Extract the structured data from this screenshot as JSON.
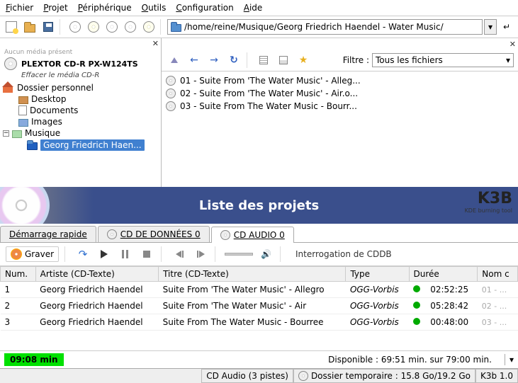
{
  "menu": {
    "file": "Fichier",
    "project": "Projet",
    "device": "Périphérique",
    "tools": "Outils",
    "config": "Configuration",
    "help": "Aide"
  },
  "path": "/home/reine/Musique/Georg Friedrich Haendel - Water Music/",
  "device": {
    "name": "PLEXTOR CD-R   PX-W124TS",
    "sub": "Effacer le média CD-R",
    "above": "Aucun média présent"
  },
  "folders": {
    "home": "Dossier personnel",
    "desktop": "Desktop",
    "documents": "Documents",
    "images": "Images",
    "music": "Musique",
    "selected": "Georg Friedrich Haen..."
  },
  "filter": {
    "label": "Filtre :",
    "value": "Tous les fichiers"
  },
  "files": [
    "01 - Suite From 'The Water Music' - Alleg...",
    "02 - Suite From 'The Water Music' - Air.o...",
    "03 - Suite From The Water Music - Bourr..."
  ],
  "project_header": {
    "title": "Liste des projets",
    "logo": "K3B",
    "logo_sub": "KDE burning tool"
  },
  "tabs": {
    "quick": "Démarrage rapide",
    "data": "CD DE DONNÉES 0",
    "audio": "CD AUDIO 0"
  },
  "proj_tb": {
    "burn": "Graver",
    "status": "Interrogation de CDDB"
  },
  "columns": {
    "num": "Num.",
    "artist": "Artiste (CD-Texte)",
    "title": "Titre (CD-Texte)",
    "type": "Type",
    "duration": "Durée",
    "filename": "Nom c"
  },
  "tracks": [
    {
      "num": "1",
      "artist": "Georg Friedrich Haendel",
      "title": "Suite From 'The Water Music' - Allegro",
      "type": "OGG-Vorbis",
      "duration": "02:52:25",
      "file": "01 - ..."
    },
    {
      "num": "2",
      "artist": "Georg Friedrich Haendel",
      "title": "Suite From 'The Water Music' - Air",
      "type": "OGG-Vorbis",
      "duration": "05:28:42",
      "file": "02 - ..."
    },
    {
      "num": "3",
      "artist": "Georg Friedrich Haendel",
      "title": "Suite From The Water Music - Bourree",
      "type": "OGG-Vorbis",
      "duration": "00:48:00",
      "file": "03 - ..."
    }
  ],
  "footer": {
    "time": "09:08 min",
    "available": "Disponible : 69:51 min. sur 79:00 min."
  },
  "status": {
    "audio": "CD Audio (3 pistes)",
    "temp": "Dossier temporaire : 15.8 Go/19.2 Go",
    "ver": "K3b 1.0"
  }
}
